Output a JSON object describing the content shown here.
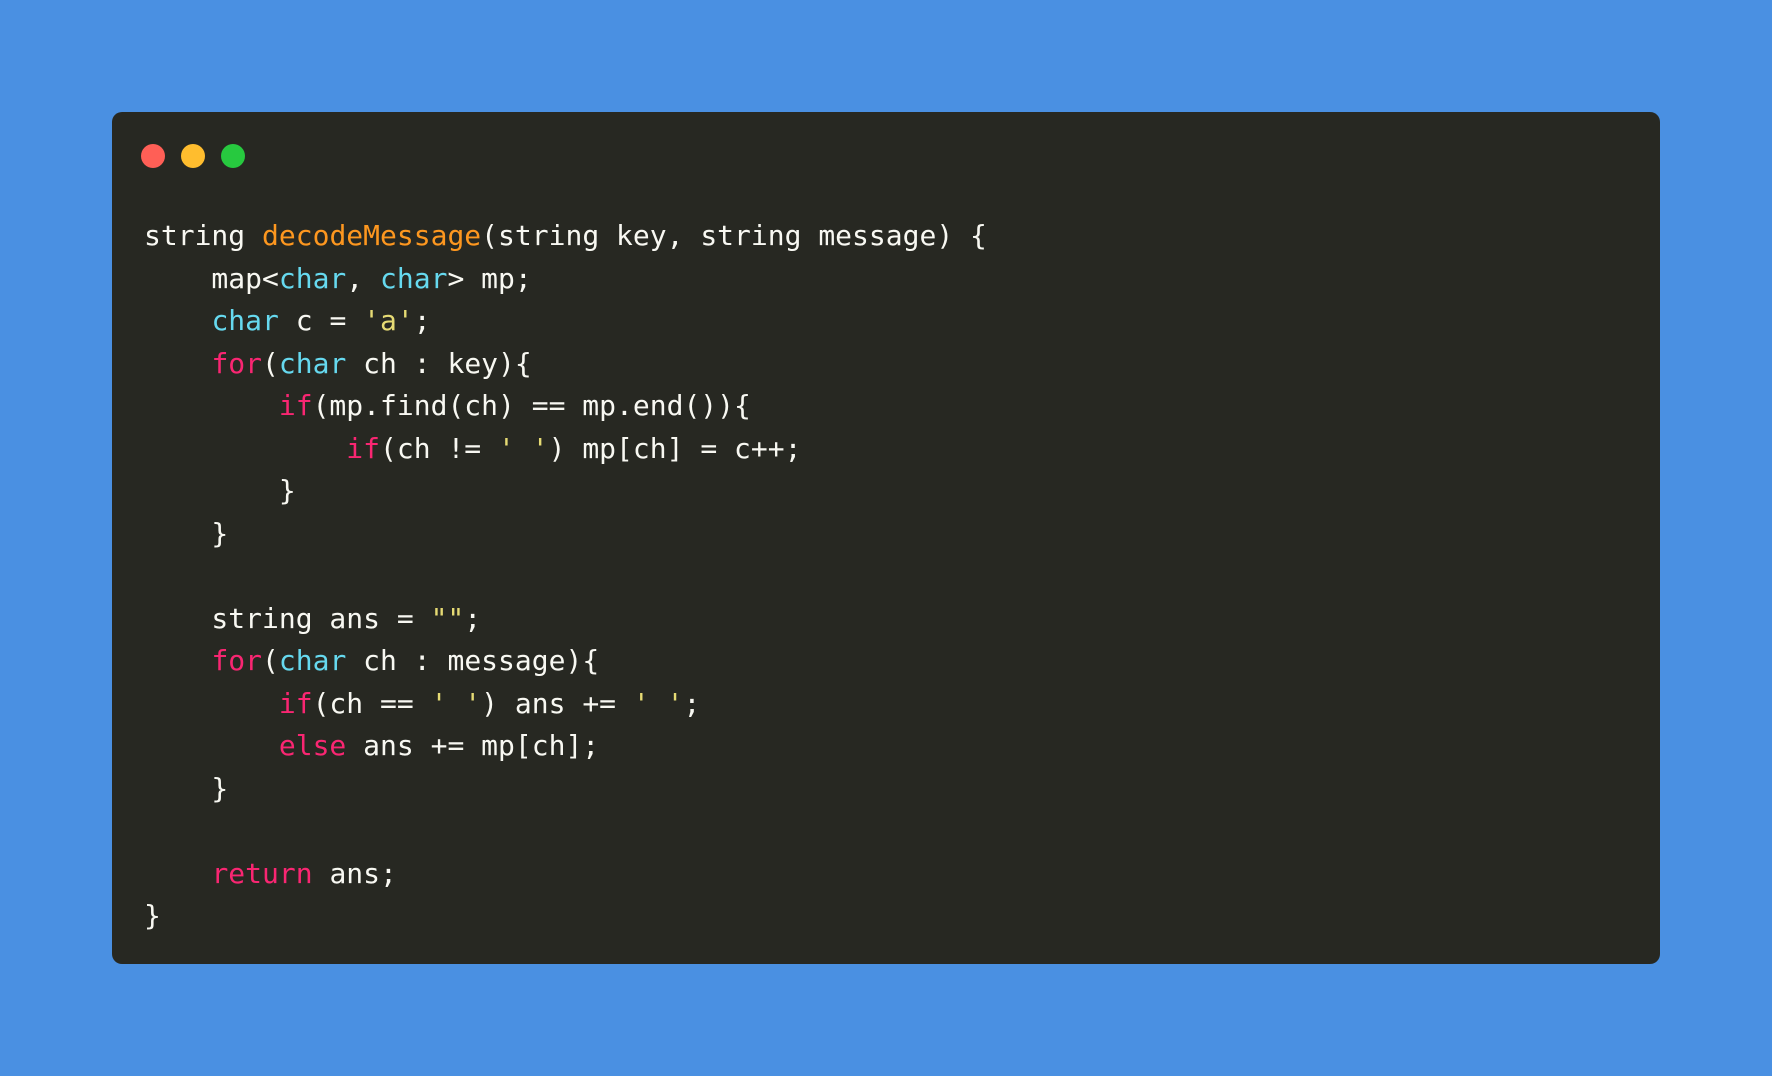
{
  "window": {
    "colors": {
      "background": "#4a90e2",
      "editor": "#272822",
      "close": "#ff5f56",
      "minimize": "#ffbd2e",
      "maximize": "#27c93f",
      "plain": "#f8f8f2",
      "function": "#fd971f",
      "type": "#66d9ef",
      "keyword": "#f92672",
      "string": "#e6db74"
    },
    "controls": [
      "close-dot-icon",
      "minimize-dot-icon",
      "maximize-dot-icon"
    ]
  },
  "code": {
    "lines": [
      [
        {
          "type": "plain",
          "text": "string "
        },
        {
          "type": "func",
          "text": "decodeMessage"
        },
        {
          "type": "plain",
          "text": "(string key, string message) {"
        }
      ],
      [
        {
          "type": "plain",
          "text": "    map<"
        },
        {
          "type": "type",
          "text": "char"
        },
        {
          "type": "plain",
          "text": ", "
        },
        {
          "type": "type",
          "text": "char"
        },
        {
          "type": "plain",
          "text": "> mp;"
        }
      ],
      [
        {
          "type": "plain",
          "text": "    "
        },
        {
          "type": "type",
          "text": "char"
        },
        {
          "type": "plain",
          "text": " c = "
        },
        {
          "type": "string",
          "text": "'a'"
        },
        {
          "type": "plain",
          "text": ";"
        }
      ],
      [
        {
          "type": "plain",
          "text": "    "
        },
        {
          "type": "keyword",
          "text": "for"
        },
        {
          "type": "plain",
          "text": "("
        },
        {
          "type": "type",
          "text": "char"
        },
        {
          "type": "plain",
          "text": " ch : key){"
        }
      ],
      [
        {
          "type": "plain",
          "text": "        "
        },
        {
          "type": "keyword",
          "text": "if"
        },
        {
          "type": "plain",
          "text": "(mp.find(ch) == mp.end()){"
        }
      ],
      [
        {
          "type": "plain",
          "text": "            "
        },
        {
          "type": "keyword",
          "text": "if"
        },
        {
          "type": "plain",
          "text": "(ch != "
        },
        {
          "type": "string",
          "text": "' '"
        },
        {
          "type": "plain",
          "text": ") mp[ch] = c++;"
        }
      ],
      [
        {
          "type": "plain",
          "text": "        }"
        }
      ],
      [
        {
          "type": "plain",
          "text": "    }"
        }
      ],
      [
        {
          "type": "plain",
          "text": ""
        }
      ],
      [
        {
          "type": "plain",
          "text": "    string ans = "
        },
        {
          "type": "string",
          "text": "\"\""
        },
        {
          "type": "plain",
          "text": ";"
        }
      ],
      [
        {
          "type": "plain",
          "text": "    "
        },
        {
          "type": "keyword",
          "text": "for"
        },
        {
          "type": "plain",
          "text": "("
        },
        {
          "type": "type",
          "text": "char"
        },
        {
          "type": "plain",
          "text": " ch : message){"
        }
      ],
      [
        {
          "type": "plain",
          "text": "        "
        },
        {
          "type": "keyword",
          "text": "if"
        },
        {
          "type": "plain",
          "text": "(ch == "
        },
        {
          "type": "string",
          "text": "' '"
        },
        {
          "type": "plain",
          "text": ") ans += "
        },
        {
          "type": "string",
          "text": "' '"
        },
        {
          "type": "plain",
          "text": ";"
        }
      ],
      [
        {
          "type": "plain",
          "text": "        "
        },
        {
          "type": "keyword",
          "text": "else"
        },
        {
          "type": "plain",
          "text": " ans += mp[ch];"
        }
      ],
      [
        {
          "type": "plain",
          "text": "    }"
        }
      ],
      [
        {
          "type": "plain",
          "text": ""
        }
      ],
      [
        {
          "type": "plain",
          "text": "    "
        },
        {
          "type": "keyword",
          "text": "return"
        },
        {
          "type": "plain",
          "text": " ans;"
        }
      ],
      [
        {
          "type": "plain",
          "text": "}"
        }
      ]
    ]
  }
}
